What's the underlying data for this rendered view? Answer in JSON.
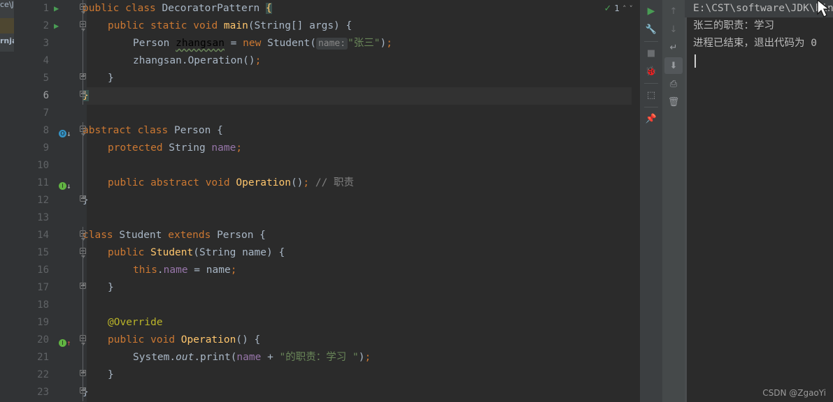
{
  "editor": {
    "file_tab_fragment_top": "ce\\J",
    "file_tab_fragment_bottom": "rnjav",
    "inspection": {
      "status_icon": "green-check-icon",
      "count": "1",
      "up_label": "˄",
      "down_label": "˅"
    },
    "lines": [
      {
        "num": "1",
        "runnable": true,
        "fold": "top",
        "marker": null,
        "current": false,
        "indent": 0,
        "tokens": [
          {
            "t": "public",
            "c": "kw"
          },
          {
            "t": " ",
            "c": "txt"
          },
          {
            "t": "class",
            "c": "kw"
          },
          {
            "t": " ",
            "c": "txt"
          },
          {
            "t": "DecoratorPattern",
            "c": "cls"
          },
          {
            "t": " ",
            "c": "txt"
          },
          {
            "t": "{",
            "c": "brace-hl"
          }
        ]
      },
      {
        "num": "2",
        "runnable": true,
        "fold": "top",
        "marker": null,
        "current": false,
        "indent": 1,
        "tokens": [
          {
            "t": "public",
            "c": "kw"
          },
          {
            "t": " ",
            "c": "txt"
          },
          {
            "t": "static",
            "c": "kw"
          },
          {
            "t": " ",
            "c": "txt"
          },
          {
            "t": "void",
            "c": "kw"
          },
          {
            "t": " ",
            "c": "txt"
          },
          {
            "t": "main",
            "c": "mth"
          },
          {
            "t": "(String[] args) {",
            "c": "txt"
          }
        ]
      },
      {
        "num": "3",
        "runnable": false,
        "fold": null,
        "marker": null,
        "current": false,
        "indent": 2,
        "tokens": [
          {
            "t": "Person ",
            "c": "txt"
          },
          {
            "t": "zhangsan",
            "c": "squiggle"
          },
          {
            "t": " = ",
            "c": "txt"
          },
          {
            "t": "new",
            "c": "kw"
          },
          {
            "t": " Student(",
            "c": "txt"
          },
          {
            "t": "name:",
            "c": "hint"
          },
          {
            "t": "\"张三\"",
            "c": "str"
          },
          {
            "t": ")",
            "c": "txt"
          },
          {
            "t": ";",
            "c": "kw"
          }
        ]
      },
      {
        "num": "4",
        "runnable": false,
        "fold": null,
        "marker": null,
        "current": false,
        "indent": 2,
        "tokens": [
          {
            "t": "zhangsan.Operation()",
            "c": "txt"
          },
          {
            "t": ";",
            "c": "kw"
          }
        ]
      },
      {
        "num": "5",
        "runnable": false,
        "fold": "bottom",
        "marker": null,
        "current": false,
        "indent": 1,
        "tokens": [
          {
            "t": "}",
            "c": "txt"
          }
        ]
      },
      {
        "num": "6",
        "runnable": false,
        "fold": "bottom",
        "marker": null,
        "current": true,
        "indent": 0,
        "tokens": [
          {
            "t": "}",
            "c": "brace-hl"
          }
        ]
      },
      {
        "num": "7",
        "runnable": false,
        "fold": null,
        "marker": null,
        "current": false,
        "indent": 0,
        "tokens": []
      },
      {
        "num": "8",
        "runnable": false,
        "fold": "top",
        "marker": {
          "kind": "blue",
          "glyph": "O",
          "arrow": "down"
        },
        "current": false,
        "indent": 0,
        "tokens": [
          {
            "t": "abstract",
            "c": "kw"
          },
          {
            "t": " ",
            "c": "txt"
          },
          {
            "t": "class",
            "c": "kw"
          },
          {
            "t": " Person {",
            "c": "txt"
          }
        ]
      },
      {
        "num": "9",
        "runnable": false,
        "fold": null,
        "marker": null,
        "current": false,
        "indent": 1,
        "tokens": [
          {
            "t": "protected",
            "c": "kw"
          },
          {
            "t": " String ",
            "c": "txt"
          },
          {
            "t": "name",
            "c": "fld"
          },
          {
            "t": ";",
            "c": "kw"
          }
        ]
      },
      {
        "num": "10",
        "runnable": false,
        "fold": null,
        "marker": null,
        "current": false,
        "indent": 0,
        "tokens": []
      },
      {
        "num": "11",
        "runnable": false,
        "fold": null,
        "marker": {
          "kind": "green",
          "glyph": "I",
          "arrow": "down"
        },
        "current": false,
        "indent": 1,
        "tokens": [
          {
            "t": "public",
            "c": "kw"
          },
          {
            "t": " ",
            "c": "txt"
          },
          {
            "t": "abstract",
            "c": "kw"
          },
          {
            "t": " ",
            "c": "txt"
          },
          {
            "t": "void",
            "c": "kw"
          },
          {
            "t": " ",
            "c": "txt"
          },
          {
            "t": "Operation",
            "c": "mth"
          },
          {
            "t": "()",
            "c": "txt"
          },
          {
            "t": ";",
            "c": "kw"
          },
          {
            "t": " // 职责",
            "c": "cmt"
          }
        ]
      },
      {
        "num": "12",
        "runnable": false,
        "fold": "bottom",
        "marker": null,
        "current": false,
        "indent": 0,
        "tokens": [
          {
            "t": "}",
            "c": "txt"
          }
        ]
      },
      {
        "num": "13",
        "runnable": false,
        "fold": null,
        "marker": null,
        "current": false,
        "indent": 0,
        "tokens": []
      },
      {
        "num": "14",
        "runnable": false,
        "fold": "top",
        "marker": null,
        "current": false,
        "indent": 0,
        "tokens": [
          {
            "t": "class",
            "c": "kw"
          },
          {
            "t": " Student ",
            "c": "txt"
          },
          {
            "t": "extends",
            "c": "kw"
          },
          {
            "t": " Person {",
            "c": "txt"
          }
        ]
      },
      {
        "num": "15",
        "runnable": false,
        "fold": "top",
        "marker": null,
        "current": false,
        "indent": 1,
        "tokens": [
          {
            "t": "public",
            "c": "kw"
          },
          {
            "t": " ",
            "c": "txt"
          },
          {
            "t": "Student",
            "c": "mth"
          },
          {
            "t": "(String name) {",
            "c": "txt"
          }
        ]
      },
      {
        "num": "16",
        "runnable": false,
        "fold": null,
        "marker": null,
        "current": false,
        "indent": 2,
        "tokens": [
          {
            "t": "this",
            "c": "kw"
          },
          {
            "t": ".",
            "c": "txt"
          },
          {
            "t": "name",
            "c": "fld"
          },
          {
            "t": " = name",
            "c": "txt"
          },
          {
            "t": ";",
            "c": "kw"
          }
        ]
      },
      {
        "num": "17",
        "runnable": false,
        "fold": "bottom",
        "marker": null,
        "current": false,
        "indent": 1,
        "tokens": [
          {
            "t": "}",
            "c": "txt"
          }
        ]
      },
      {
        "num": "18",
        "runnable": false,
        "fold": null,
        "marker": null,
        "current": false,
        "indent": 0,
        "tokens": []
      },
      {
        "num": "19",
        "runnable": false,
        "fold": null,
        "marker": null,
        "current": false,
        "indent": 1,
        "tokens": [
          {
            "t": "@Override",
            "c": "ann"
          }
        ]
      },
      {
        "num": "20",
        "runnable": false,
        "fold": "top",
        "marker": {
          "kind": "green",
          "glyph": "I",
          "arrow": "up"
        },
        "current": false,
        "indent": 1,
        "tokens": [
          {
            "t": "public",
            "c": "kw"
          },
          {
            "t": " ",
            "c": "txt"
          },
          {
            "t": "void",
            "c": "kw"
          },
          {
            "t": " ",
            "c": "txt"
          },
          {
            "t": "Operation",
            "c": "mth"
          },
          {
            "t": "() {",
            "c": "txt"
          }
        ]
      },
      {
        "num": "21",
        "runnable": false,
        "fold": null,
        "marker": null,
        "current": false,
        "indent": 2,
        "tokens": [
          {
            "t": "System.",
            "c": "txt"
          },
          {
            "t": "out",
            "c": "stat"
          },
          {
            "t": ".print(",
            "c": "txt"
          },
          {
            "t": "name",
            "c": "fld"
          },
          {
            "t": " + ",
            "c": "txt"
          },
          {
            "t": "\"的职责：学习 \"",
            "c": "str"
          },
          {
            "t": ")",
            "c": "txt"
          },
          {
            "t": ";",
            "c": "kw"
          }
        ]
      },
      {
        "num": "22",
        "runnable": false,
        "fold": "bottom",
        "marker": null,
        "current": false,
        "indent": 1,
        "tokens": [
          {
            "t": "}",
            "c": "txt"
          }
        ]
      },
      {
        "num": "23",
        "runnable": false,
        "fold": "bottom",
        "marker": null,
        "current": false,
        "indent": 0,
        "tokens": [
          {
            "t": "}",
            "c": "txt"
          }
        ]
      }
    ]
  },
  "run_toolbar_primary": [
    {
      "name": "rerun-button",
      "glyph": "▶",
      "style": "run",
      "selected": false
    },
    {
      "name": "settings-wrench-icon",
      "glyph": "🔧",
      "style": "",
      "selected": false
    },
    {
      "name": "stop-button",
      "glyph": "■",
      "style": "dim",
      "selected": false
    },
    {
      "name": "debug-button",
      "glyph": "🐞",
      "style": "dim",
      "selected": false
    },
    {
      "name": "layout-button",
      "glyph": "⬚",
      "style": "",
      "selected": false
    },
    {
      "name": "pin-tab-button",
      "glyph": "📌",
      "style": "",
      "selected": false
    }
  ],
  "run_toolbar_secondary": [
    {
      "name": "scroll-up-button",
      "glyph": "↑",
      "style": "dim",
      "selected": false
    },
    {
      "name": "scroll-down-button",
      "glyph": "↓",
      "style": "dim",
      "selected": false
    },
    {
      "name": "soft-wrap-button",
      "glyph": "↵",
      "style": "",
      "selected": false
    },
    {
      "name": "scroll-to-end-button",
      "glyph": "⬇",
      "style": "",
      "selected": true
    },
    {
      "name": "print-button",
      "glyph": "⎙",
      "style": "",
      "selected": false
    },
    {
      "name": "clear-all-button",
      "glyph": "🗑",
      "style": "",
      "selected": false
    }
  ],
  "console": {
    "command_line": "E:\\CST\\software\\JDK\\bin\\j",
    "output_lines": [
      "张三的职责：学习",
      "进程已结束，退出代码为 0"
    ],
    "watermark": "CSDN @ZgaoYi"
  }
}
